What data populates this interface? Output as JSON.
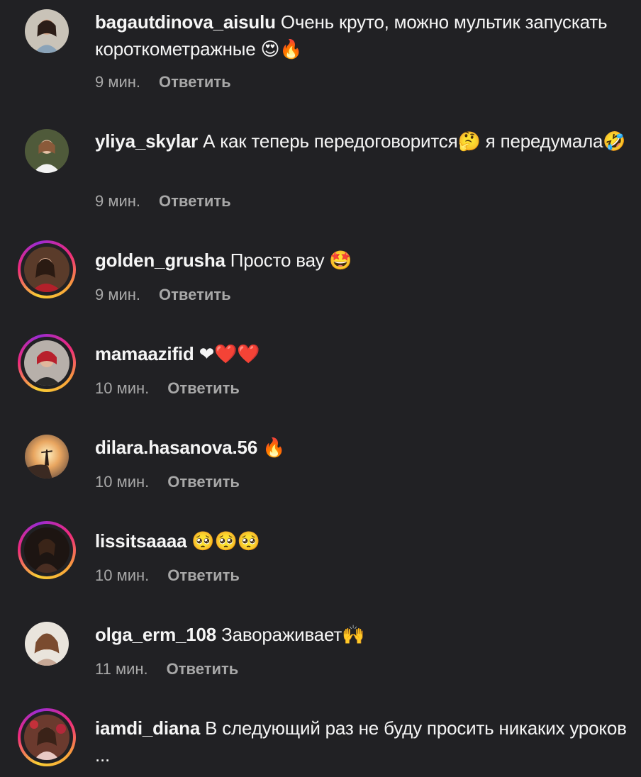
{
  "comments": [
    {
      "username": "bagautdinova_aisulu",
      "text": "Очень круто, можно мультик запускать короткометражные 😍🔥",
      "time": "9 мин.",
      "reply": "Ответить",
      "avatar_story": false
    },
    {
      "username": "yliya_skylar",
      "text": "А как теперь передоговорится🤔 я передумала🤣",
      "time": "9 мин.",
      "reply": "Ответить",
      "avatar_story": false
    },
    {
      "username": "golden_grusha",
      "text": "Просто вау 🤩",
      "time": "9 мин.",
      "reply": "Ответить",
      "avatar_story": true
    },
    {
      "username": "mamaazifid",
      "text": "❤❤️❤️",
      "time": "10 мин.",
      "reply": "Ответить",
      "avatar_story": true
    },
    {
      "username": "dilara.hasanova.56",
      "text": "🔥",
      "time": "10 мин.",
      "reply": "Ответить",
      "avatar_story": false
    },
    {
      "username": "lissitsaaaa",
      "text": "🥺🥺🥺",
      "time": "10 мин.",
      "reply": "Ответить",
      "avatar_story": true
    },
    {
      "username": "olga_erm_108",
      "text": "Завораживает🙌",
      "time": "11 мин.",
      "reply": "Ответить",
      "avatar_story": false
    },
    {
      "username": "iamdi_diana",
      "text": "В следующий раз не буду просить никаких уроков ...",
      "time": "",
      "reply": "",
      "avatar_story": true
    }
  ],
  "colors": {
    "background": "#212124",
    "text": "#f5f5f5",
    "meta": "#a8a8a8"
  }
}
